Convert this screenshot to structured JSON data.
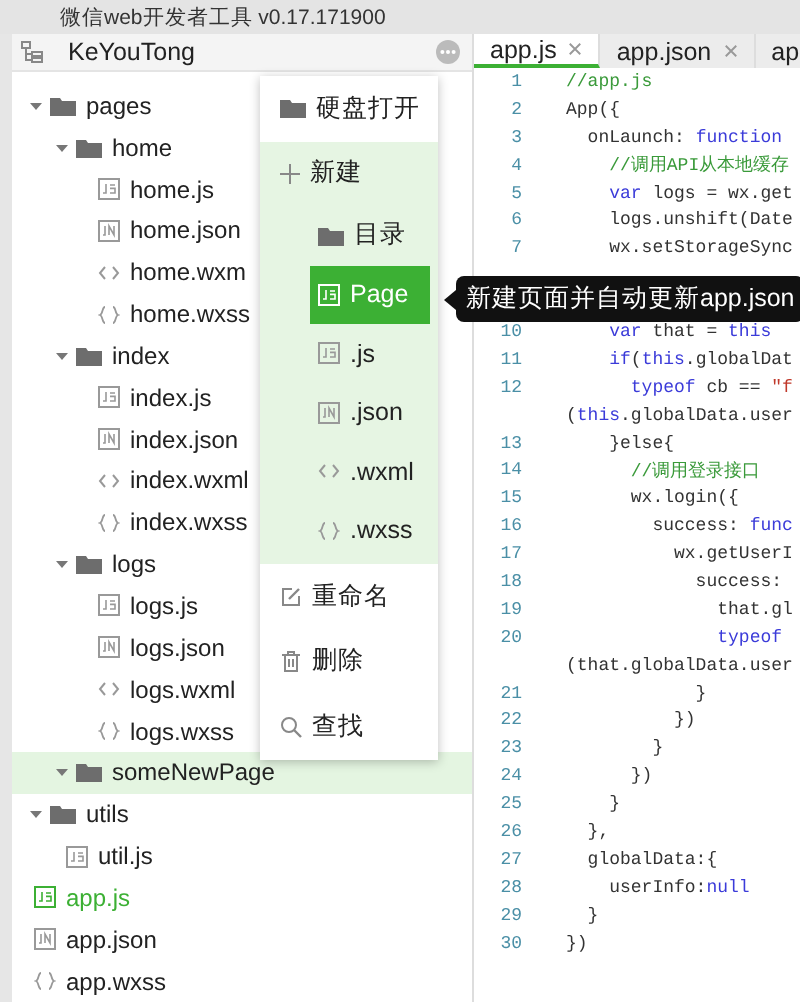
{
  "window": {
    "title": "微信web开发者工具 v0.17.171900"
  },
  "project": {
    "name": "KeYouTong"
  },
  "tree": [
    {
      "name": "pages",
      "kind": "folder",
      "expanded": true,
      "selected": false,
      "current": false,
      "children": [
        {
          "name": "home",
          "kind": "folder",
          "expanded": true,
          "selected": false,
          "current": false,
          "children": [
            {
              "name": "home.js",
              "kind": "js",
              "selected": false,
              "current": false
            },
            {
              "name": "home.json",
              "kind": "json",
              "selected": false,
              "current": false
            },
            {
              "name": "home.wxm",
              "kind": "wxml",
              "selected": false,
              "current": false
            },
            {
              "name": "home.wxss",
              "kind": "wxss",
              "selected": false,
              "current": false
            }
          ]
        },
        {
          "name": "index",
          "kind": "folder",
          "expanded": true,
          "selected": false,
          "current": false,
          "children": [
            {
              "name": "index.js",
              "kind": "js",
              "selected": false,
              "current": false
            },
            {
              "name": "index.json",
              "kind": "json",
              "selected": false,
              "current": false
            },
            {
              "name": "index.wxml",
              "kind": "wxml",
              "selected": false,
              "current": false
            },
            {
              "name": "index.wxss",
              "kind": "wxss",
              "selected": false,
              "current": false
            }
          ]
        },
        {
          "name": "logs",
          "kind": "folder",
          "expanded": true,
          "selected": false,
          "current": false,
          "children": [
            {
              "name": "logs.js",
              "kind": "js",
              "selected": false,
              "current": false
            },
            {
              "name": "logs.json",
              "kind": "json",
              "selected": false,
              "current": false
            },
            {
              "name": "logs.wxml",
              "kind": "wxml",
              "selected": false,
              "current": false
            },
            {
              "name": "logs.wxss",
              "kind": "wxss",
              "selected": false,
              "current": false
            }
          ]
        },
        {
          "name": "someNewPage",
          "kind": "folder",
          "expanded": true,
          "selected": true,
          "current": false
        }
      ]
    },
    {
      "name": "utils",
      "kind": "folder",
      "expanded": true,
      "selected": false,
      "current": false,
      "children": [
        {
          "name": "util.js",
          "kind": "js",
          "selected": false,
          "current": false
        }
      ]
    },
    {
      "name": "app.js",
      "kind": "js",
      "selected": false,
      "current": true
    },
    {
      "name": "app.json",
      "kind": "json",
      "selected": false,
      "current": false
    },
    {
      "name": "app.wxss",
      "kind": "wxss",
      "selected": false,
      "current": false
    }
  ],
  "context_menu": [
    {
      "label": "硬盘打开",
      "kind": "folder",
      "selected": false
    },
    {
      "label": "新建",
      "kind": "plus",
      "expanded": true,
      "children": [
        {
          "label": "目录",
          "kind": "folder",
          "selected": false
        },
        {
          "label": "Page",
          "kind": "js",
          "selected": true
        },
        {
          "label": ".js",
          "kind": "js",
          "selected": false
        },
        {
          "label": ".json",
          "kind": "json",
          "selected": false
        },
        {
          "label": ".wxml",
          "kind": "wxml",
          "selected": false
        },
        {
          "label": ".wxss",
          "kind": "wxss",
          "selected": false
        }
      ]
    },
    {
      "label": "重命名",
      "kind": "edit",
      "selected": false
    },
    {
      "label": "删除",
      "kind": "trash",
      "selected": false
    },
    {
      "label": "查找",
      "kind": "search",
      "selected": false
    }
  ],
  "tooltip": "新建页面并自动更新app.json",
  "tabs": [
    {
      "label": "app.js",
      "selected": true,
      "closable": true
    },
    {
      "label": "app.json",
      "selected": false,
      "closable": true
    },
    {
      "label": "ap",
      "selected": false,
      "closable": false
    }
  ],
  "code": [
    {
      "kind": "line",
      "num": "1",
      "parts": [
        {
          "t": "//app.js",
          "kind": "comment"
        }
      ]
    },
    {
      "kind": "line",
      "num": "2",
      "parts": [
        {
          "t": "App({",
          "kind": "plain"
        }
      ]
    },
    {
      "kind": "line",
      "num": "3",
      "parts": [
        {
          "t": "  onLaunch: ",
          "kind": "plain"
        },
        {
          "t": "function",
          "kind": "keyword"
        }
      ]
    },
    {
      "kind": "line",
      "num": "4",
      "parts": [
        {
          "t": "    //调用API从本地缓存",
          "kind": "comment"
        }
      ]
    },
    {
      "kind": "line",
      "num": "5",
      "parts": [
        {
          "t": "    var",
          "kind": "keyword"
        },
        {
          "t": " logs = wx.get",
          "kind": "plain"
        }
      ]
    },
    {
      "kind": "line",
      "num": "6",
      "parts": [
        {
          "t": "    logs.unshift(Date",
          "kind": "plain"
        }
      ]
    },
    {
      "kind": "line",
      "num": "7",
      "parts": [
        {
          "t": "    wx.setStorageSync",
          "kind": "plain"
        }
      ]
    },
    {
      "kind": "hidden"
    },
    {
      "kind": "hidden"
    },
    {
      "kind": "line",
      "num": "10",
      "parts": [
        {
          "t": "    var",
          "kind": "keyword"
        },
        {
          "t": " that = ",
          "kind": "plain"
        },
        {
          "t": "this",
          "kind": "keyword"
        }
      ]
    },
    {
      "kind": "line",
      "num": "11",
      "parts": [
        {
          "t": "    if",
          "kind": "keyword"
        },
        {
          "t": "(",
          "kind": "plain"
        },
        {
          "t": "this",
          "kind": "keyword"
        },
        {
          "t": ".globalDat",
          "kind": "plain"
        }
      ]
    },
    {
      "kind": "line",
      "num": "12",
      "parts": [
        {
          "t": "      typeof",
          "kind": "keyword"
        },
        {
          "t": " cb == ",
          "kind": "plain"
        },
        {
          "t": "\"f",
          "kind": "string"
        }
      ]
    },
    {
      "kind": "wrap",
      "parts": [
        {
          "t": "(",
          "kind": "plain"
        },
        {
          "t": "this",
          "kind": "keyword"
        },
        {
          "t": ".globalData.user",
          "kind": "plain"
        }
      ]
    },
    {
      "kind": "line",
      "num": "13",
      "parts": [
        {
          "t": "    }else{",
          "kind": "plain"
        }
      ]
    },
    {
      "kind": "line",
      "num": "14",
      "parts": [
        {
          "t": "      //调用登录接口",
          "kind": "comment"
        }
      ]
    },
    {
      "kind": "line",
      "num": "15",
      "parts": [
        {
          "t": "      wx.login({",
          "kind": "plain"
        }
      ]
    },
    {
      "kind": "line",
      "num": "16",
      "parts": [
        {
          "t": "        success: ",
          "kind": "plain"
        },
        {
          "t": "func",
          "kind": "keyword"
        }
      ]
    },
    {
      "kind": "line",
      "num": "17",
      "parts": [
        {
          "t": "          wx.getUserI",
          "kind": "plain"
        }
      ]
    },
    {
      "kind": "line",
      "num": "18",
      "parts": [
        {
          "t": "            success:",
          "kind": "plain"
        }
      ]
    },
    {
      "kind": "line",
      "num": "19",
      "parts": [
        {
          "t": "              that.gl",
          "kind": "plain"
        }
      ]
    },
    {
      "kind": "line",
      "num": "20",
      "parts": [
        {
          "t": "              typeof",
          "kind": "keyword"
        }
      ]
    },
    {
      "kind": "wrap",
      "parts": [
        {
          "t": "(that.globalData.user",
          "kind": "plain"
        }
      ]
    },
    {
      "kind": "line",
      "num": "21",
      "parts": [
        {
          "t": "            }",
          "kind": "plain"
        }
      ]
    },
    {
      "kind": "line",
      "num": "22",
      "parts": [
        {
          "t": "          })",
          "kind": "plain"
        }
      ]
    },
    {
      "kind": "line",
      "num": "23",
      "parts": [
        {
          "t": "        }",
          "kind": "plain"
        }
      ]
    },
    {
      "kind": "line",
      "num": "24",
      "parts": [
        {
          "t": "      })",
          "kind": "plain"
        }
      ]
    },
    {
      "kind": "line",
      "num": "25",
      "parts": [
        {
          "t": "    }",
          "kind": "plain"
        }
      ]
    },
    {
      "kind": "line",
      "num": "26",
      "parts": [
        {
          "t": "  },",
          "kind": "plain"
        }
      ]
    },
    {
      "kind": "line",
      "num": "27",
      "parts": [
        {
          "t": "  globalData:{",
          "kind": "plain"
        }
      ]
    },
    {
      "kind": "line",
      "num": "28",
      "parts": [
        {
          "t": "    userInfo:",
          "kind": "plain"
        },
        {
          "t": "null",
          "kind": "keyword"
        }
      ]
    },
    {
      "kind": "line",
      "num": "29",
      "parts": [
        {
          "t": "  }",
          "kind": "plain"
        }
      ]
    },
    {
      "kind": "line",
      "num": "30",
      "parts": [
        {
          "t": "})",
          "kind": "plain"
        }
      ]
    }
  ]
}
